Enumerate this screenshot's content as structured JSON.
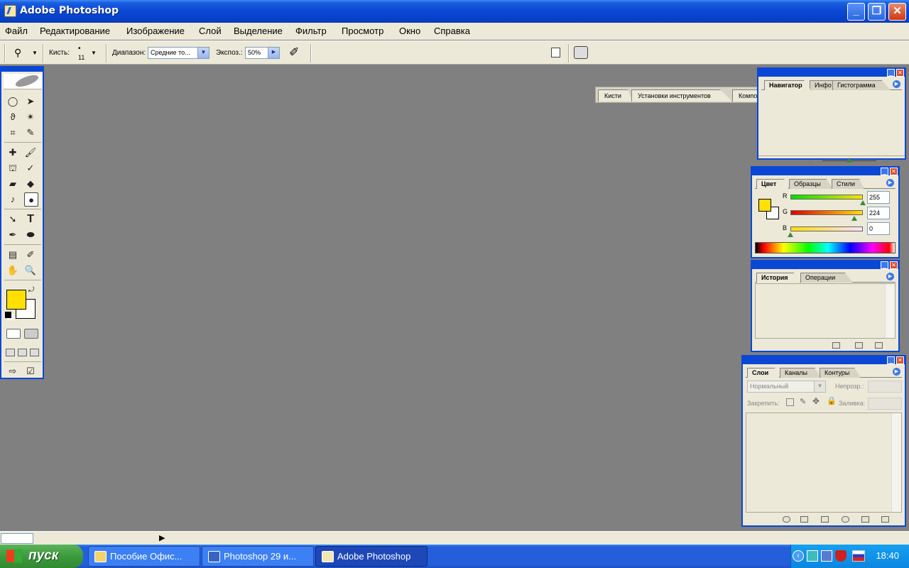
{
  "window": {
    "title": "Adobe Photoshop",
    "minimize": "_",
    "maximize": "❐",
    "close": "✕"
  },
  "menu": [
    "Файл",
    "Редактирование",
    "Изображение",
    "Слой",
    "Выделение",
    "Фильтр",
    "Просмотр",
    "Окно",
    "Справка"
  ],
  "options": {
    "brush_label": "Кисть:",
    "brush_size": "11",
    "range_label": "Диапазон:",
    "range_value": "Средние то...",
    "exposure_label": "Экспоз.:",
    "exposure_value": "50%"
  },
  "palette_well": [
    "Кисти",
    "Установки инструментов",
    "Композиции слоев"
  ],
  "tools": {
    "active": "dodge-tool"
  },
  "colors": {
    "foreground": "#ffe000",
    "background": "#ffffff",
    "accent": "#0a47d4"
  },
  "navigator_panel": {
    "tabs": [
      "Навигатор",
      "Инфо",
      "Гистограмма"
    ]
  },
  "color_panel": {
    "tabs": [
      "Цвет",
      "Образцы",
      "Стили"
    ],
    "channels": [
      {
        "label": "R",
        "value": "255",
        "level": 1.0
      },
      {
        "label": "G",
        "value": "224",
        "level": 0.878
      },
      {
        "label": "B",
        "value": "0",
        "level": 0.0
      }
    ]
  },
  "history_panel": {
    "tabs": [
      "История",
      "Операции"
    ]
  },
  "layers_panel": {
    "tabs": [
      "Слои",
      "Каналы",
      "Контуры"
    ],
    "blend_mode": "Нормальный",
    "opacity_label": "Непрозр.:",
    "lock_label": "Закрепить:",
    "fill_label": "Заливка:"
  },
  "taskbar": {
    "start_label": "пуск",
    "tasks": [
      "Пособие Офис...",
      "Photoshop 29 и...",
      "Adobe Photoshop"
    ],
    "clock": "18:40"
  }
}
